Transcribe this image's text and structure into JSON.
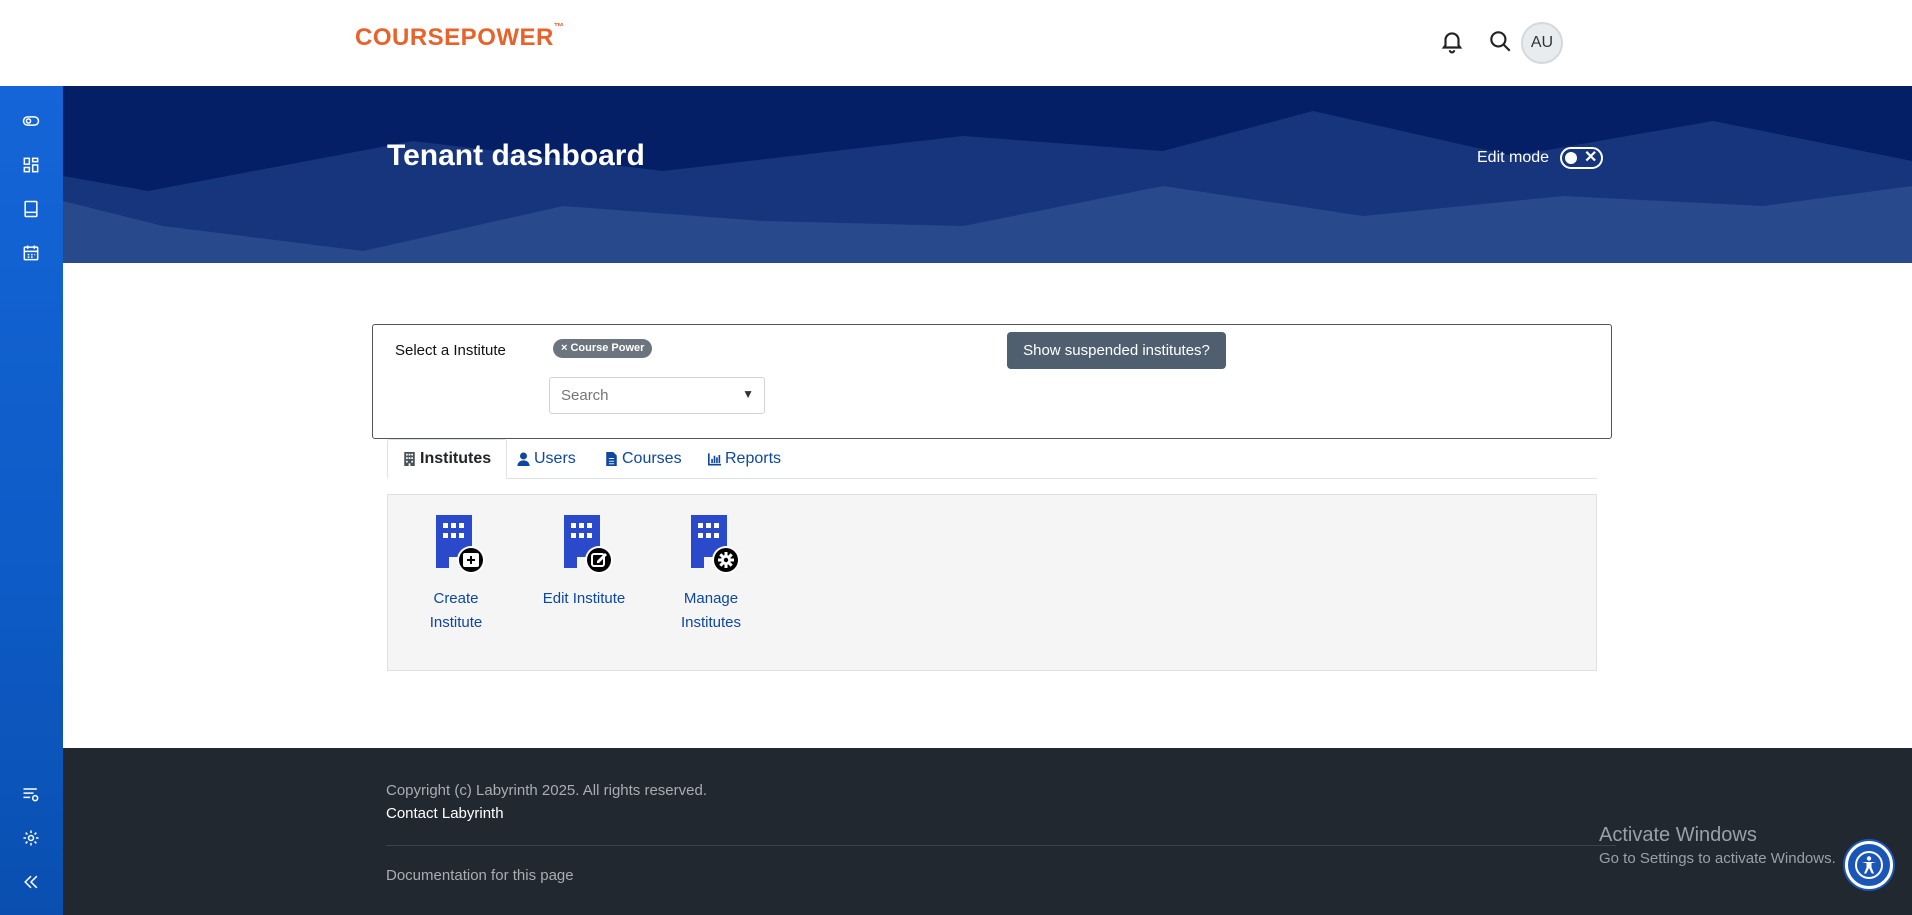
{
  "header": {
    "logo_text": "COURSEPOWER",
    "logo_tm": "™",
    "avatar_initials": "AU",
    "brand_color": "#e8622c"
  },
  "sidebar": {
    "items": [
      {
        "icon": "toggle-icon"
      },
      {
        "icon": "dashboard-icon"
      },
      {
        "icon": "book-icon"
      },
      {
        "icon": "calendar-icon"
      },
      {
        "icon": "list-settings-icon"
      },
      {
        "icon": "gear-icon"
      },
      {
        "icon": "collapse-icon"
      }
    ]
  },
  "banner": {
    "title": "Tenant dashboard",
    "edit_mode_label": "Edit mode",
    "edit_mode_on": false
  },
  "institute_select": {
    "label": "Select a Institute",
    "chip_label": "× Course Power",
    "search_placeholder": "Search",
    "suspended_button": "Show suspended institutes?"
  },
  "tabs": [
    {
      "label": "Institutes",
      "active": true,
      "icon": "building-icon"
    },
    {
      "label": "Users",
      "active": false,
      "icon": "user-icon"
    },
    {
      "label": "Courses",
      "active": false,
      "icon": "file-icon"
    },
    {
      "label": "Reports",
      "active": false,
      "icon": "chart-icon"
    }
  ],
  "actions": [
    {
      "line1": "Create",
      "line2": "Institute",
      "icon": "create-institute-icon"
    },
    {
      "line1": "Edit Institute",
      "line2": "",
      "icon": "edit-institute-icon"
    },
    {
      "line1": "Manage",
      "line2": "Institutes",
      "icon": "manage-institutes-icon"
    }
  ],
  "footer": {
    "copyright": "Copyright (c) Labyrinth 2025. All rights reserved.",
    "contact": "Contact Labyrinth",
    "docs": "Documentation for this page"
  },
  "windows_watermark": {
    "line1": "Activate Windows",
    "line2": "Go to Settings to activate Windows."
  }
}
